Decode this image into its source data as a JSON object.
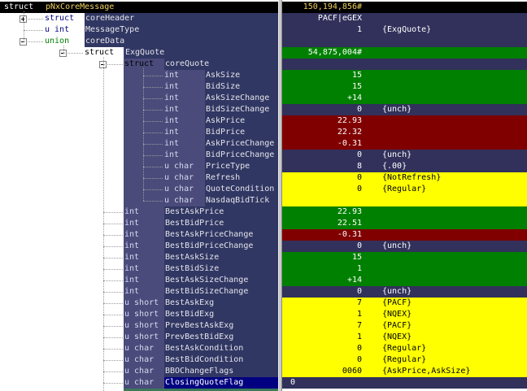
{
  "colors": {
    "green": "#008000",
    "red": "#800000",
    "yellow": "#ffff00",
    "ann_on_dark": "#ffffff"
  },
  "rows": [
    {
      "level": 0,
      "type": "struct",
      "name": "pNxCoreMessage",
      "value": "150,194,856#",
      "annotation": "",
      "bg": "black",
      "toggle": "",
      "left_bg": "black",
      "name_style": "blk",
      "type_color": "#ffffff",
      "val_color": "#f2d15b"
    },
    {
      "level": 1,
      "type": "struct",
      "name": "coreHeader",
      "value": "PACF|eGEX",
      "annotation": "",
      "bg": "dark",
      "toggle": "plus",
      "left_bg": "white",
      "name_style": "bl",
      "type_color": "#00007f"
    },
    {
      "level": 1,
      "type": "u int",
      "name": "MessageType",
      "value": "1",
      "annotation": "{ExgQuote}",
      "bg": "dark",
      "toggle": "",
      "left_bg": "white",
      "name_style": "bl",
      "type_color": "#00007f"
    },
    {
      "level": 1,
      "type": "union",
      "name": "coreData",
      "value": "",
      "annotation": "",
      "bg": "dark",
      "toggle": "minus",
      "left_bg": "white",
      "name_style": "bl",
      "type_color": "#008000"
    },
    {
      "level": 2,
      "type": "struct",
      "name": "ExgQuote",
      "value": "54,875,004#",
      "annotation": "",
      "bg": "green",
      "toggle": "minus",
      "left_bg": "blue",
      "name_style": "bl",
      "type_color": "#000000"
    },
    {
      "level": 3,
      "type": "struct",
      "name": "coreQuote",
      "value": "",
      "annotation": "",
      "bg": "dark",
      "toggle": "minus",
      "left_bg": "blue",
      "name_style": "bl",
      "type_color": "#000000"
    },
    {
      "level": 4,
      "type": "int",
      "name": "AskSize",
      "value": "15",
      "annotation": "",
      "bg": "green",
      "toggle": "",
      "left_bg": "blue",
      "name_style": "bl",
      "type_color": "#d8d8f0"
    },
    {
      "level": 4,
      "type": "int",
      "name": "BidSize",
      "value": "15",
      "annotation": "",
      "bg": "green",
      "toggle": "",
      "left_bg": "blue",
      "name_style": "bl",
      "type_color": "#d8d8f0"
    },
    {
      "level": 4,
      "type": "int",
      "name": "AskSizeChange",
      "value": "+14",
      "annotation": "",
      "bg": "green",
      "toggle": "",
      "left_bg": "blue",
      "name_style": "bl",
      "type_color": "#d8d8f0"
    },
    {
      "level": 4,
      "type": "int",
      "name": "BidSizeChange",
      "value": "0",
      "annotation": "{unch}",
      "bg": "dark",
      "toggle": "",
      "left_bg": "blue",
      "name_style": "bl",
      "type_color": "#d8d8f0"
    },
    {
      "level": 4,
      "type": "int",
      "name": "AskPrice",
      "value": "22.93",
      "annotation": "",
      "bg": "red",
      "toggle": "",
      "left_bg": "blue",
      "name_style": "bl",
      "type_color": "#d8d8f0"
    },
    {
      "level": 4,
      "type": "int",
      "name": "BidPrice",
      "value": "22.32",
      "annotation": "",
      "bg": "red",
      "toggle": "",
      "left_bg": "blue",
      "name_style": "bl",
      "type_color": "#d8d8f0"
    },
    {
      "level": 4,
      "type": "int",
      "name": "AskPriceChange",
      "value": "-0.31",
      "annotation": "",
      "bg": "red",
      "toggle": "",
      "left_bg": "blue",
      "name_style": "bl",
      "type_color": "#d8d8f0"
    },
    {
      "level": 4,
      "type": "int",
      "name": "BidPriceChange",
      "value": "0",
      "annotation": "{unch}",
      "bg": "dark",
      "toggle": "",
      "left_bg": "blue",
      "name_style": "bl",
      "type_color": "#d8d8f0"
    },
    {
      "level": 4,
      "type": "u char",
      "name": "PriceType",
      "value": "8",
      "annotation": "{.00}",
      "bg": "dark",
      "toggle": "",
      "left_bg": "blue",
      "name_style": "bl",
      "type_color": "#d8d8f0"
    },
    {
      "level": 4,
      "type": "u char",
      "name": "Refresh",
      "value": "0",
      "annotation": "{NotRefresh}",
      "bg": "yellow",
      "toggle": "",
      "left_bg": "blue",
      "name_style": "bl",
      "type_color": "#d8d8f0"
    },
    {
      "level": 4,
      "type": "u char",
      "name": "QuoteCondition",
      "value": "0",
      "annotation": "{Regular}",
      "bg": "yellow",
      "toggle": "",
      "left_bg": "blue",
      "name_style": "bl",
      "type_color": "#d8d8f0"
    },
    {
      "level": 4,
      "type": "u char",
      "name": "NasdaqBidTick",
      "value": "",
      "annotation": "",
      "bg": "yellow",
      "toggle": "",
      "left_bg": "blue",
      "name_style": "bl",
      "type_color": "#d8d8f0"
    },
    {
      "level": 3,
      "type": "int",
      "name": "BestAskPrice",
      "value": "22.93",
      "annotation": "",
      "bg": "green",
      "toggle": "",
      "left_bg": "blue",
      "name_style": "bl",
      "type_color": "#d8d8f0"
    },
    {
      "level": 3,
      "type": "int",
      "name": "BestBidPrice",
      "value": "22.51",
      "annotation": "",
      "bg": "green",
      "toggle": "",
      "left_bg": "blue",
      "name_style": "bl",
      "type_color": "#d8d8f0"
    },
    {
      "level": 3,
      "type": "int",
      "name": "BestAskPriceChange",
      "value": "-0.31",
      "annotation": "",
      "bg": "red",
      "toggle": "",
      "left_bg": "blue",
      "name_style": "bl",
      "type_color": "#d8d8f0"
    },
    {
      "level": 3,
      "type": "int",
      "name": "BestBidPriceChange",
      "value": "0",
      "annotation": "{unch}",
      "bg": "dark",
      "toggle": "",
      "left_bg": "blue",
      "name_style": "bl",
      "type_color": "#d8d8f0"
    },
    {
      "level": 3,
      "type": "int",
      "name": "BestAskSize",
      "value": "15",
      "annotation": "",
      "bg": "green",
      "toggle": "",
      "left_bg": "blue",
      "name_style": "bl",
      "type_color": "#d8d8f0"
    },
    {
      "level": 3,
      "type": "int",
      "name": "BestBidSize",
      "value": "1",
      "annotation": "",
      "bg": "green",
      "toggle": "",
      "left_bg": "blue",
      "name_style": "bl",
      "type_color": "#d8d8f0"
    },
    {
      "level": 3,
      "type": "int",
      "name": "BestAskSizeChange",
      "value": "+14",
      "annotation": "",
      "bg": "green",
      "toggle": "",
      "left_bg": "blue",
      "name_style": "bl",
      "type_color": "#d8d8f0"
    },
    {
      "level": 3,
      "type": "int",
      "name": "BestBidSizeChange",
      "value": "0",
      "annotation": "{unch}",
      "bg": "dark",
      "toggle": "",
      "left_bg": "blue",
      "name_style": "bl",
      "type_color": "#d8d8f0"
    },
    {
      "level": 3,
      "type": "u short",
      "name": "BestAskExg",
      "value": "7",
      "annotation": "{PACF}",
      "bg": "yellow",
      "toggle": "",
      "left_bg": "blue",
      "name_style": "bl",
      "type_color": "#d8d8f0"
    },
    {
      "level": 3,
      "type": "u short",
      "name": "BestBidExg",
      "value": "1",
      "annotation": "{NQEX}",
      "bg": "yellow",
      "toggle": "",
      "left_bg": "blue",
      "name_style": "bl",
      "type_color": "#d8d8f0"
    },
    {
      "level": 3,
      "type": "u short",
      "name": "PrevBestAskExg",
      "value": "7",
      "annotation": "{PACF}",
      "bg": "yellow",
      "toggle": "",
      "left_bg": "blue",
      "name_style": "bl",
      "type_color": "#d8d8f0"
    },
    {
      "level": 3,
      "type": "u short",
      "name": "PrevBestBidExg",
      "value": "1",
      "annotation": "{NQEX}",
      "bg": "yellow",
      "toggle": "",
      "left_bg": "blue",
      "name_style": "bl",
      "type_color": "#d8d8f0"
    },
    {
      "level": 3,
      "type": "u char",
      "name": "BestAskCondition",
      "value": "0",
      "annotation": "{Regular}",
      "bg": "yellow",
      "toggle": "",
      "left_bg": "blue",
      "name_style": "bl",
      "type_color": "#d8d8f0"
    },
    {
      "level": 3,
      "type": "u char",
      "name": "BestBidCondition",
      "value": "0",
      "annotation": "{Regular}",
      "bg": "yellow",
      "toggle": "",
      "left_bg": "blue",
      "name_style": "bl",
      "type_color": "#d8d8f0"
    },
    {
      "level": 3,
      "type": "u char",
      "name": "BBOChangeFlags",
      "value": "0060",
      "annotation": "{AskPrice,AskSize}",
      "bg": "yellow",
      "toggle": "",
      "left_bg": "blue",
      "name_style": "bl",
      "type_color": "#d8d8f0"
    },
    {
      "level": 3,
      "type": "u char",
      "name": "ClosingQuoteFlag",
      "value": "0",
      "annotation": "",
      "bg": "dark",
      "toggle": "",
      "left_bg": "blue",
      "name_style": "sel",
      "type_color": "#d8d8f0",
      "val_align": "left"
    }
  ]
}
